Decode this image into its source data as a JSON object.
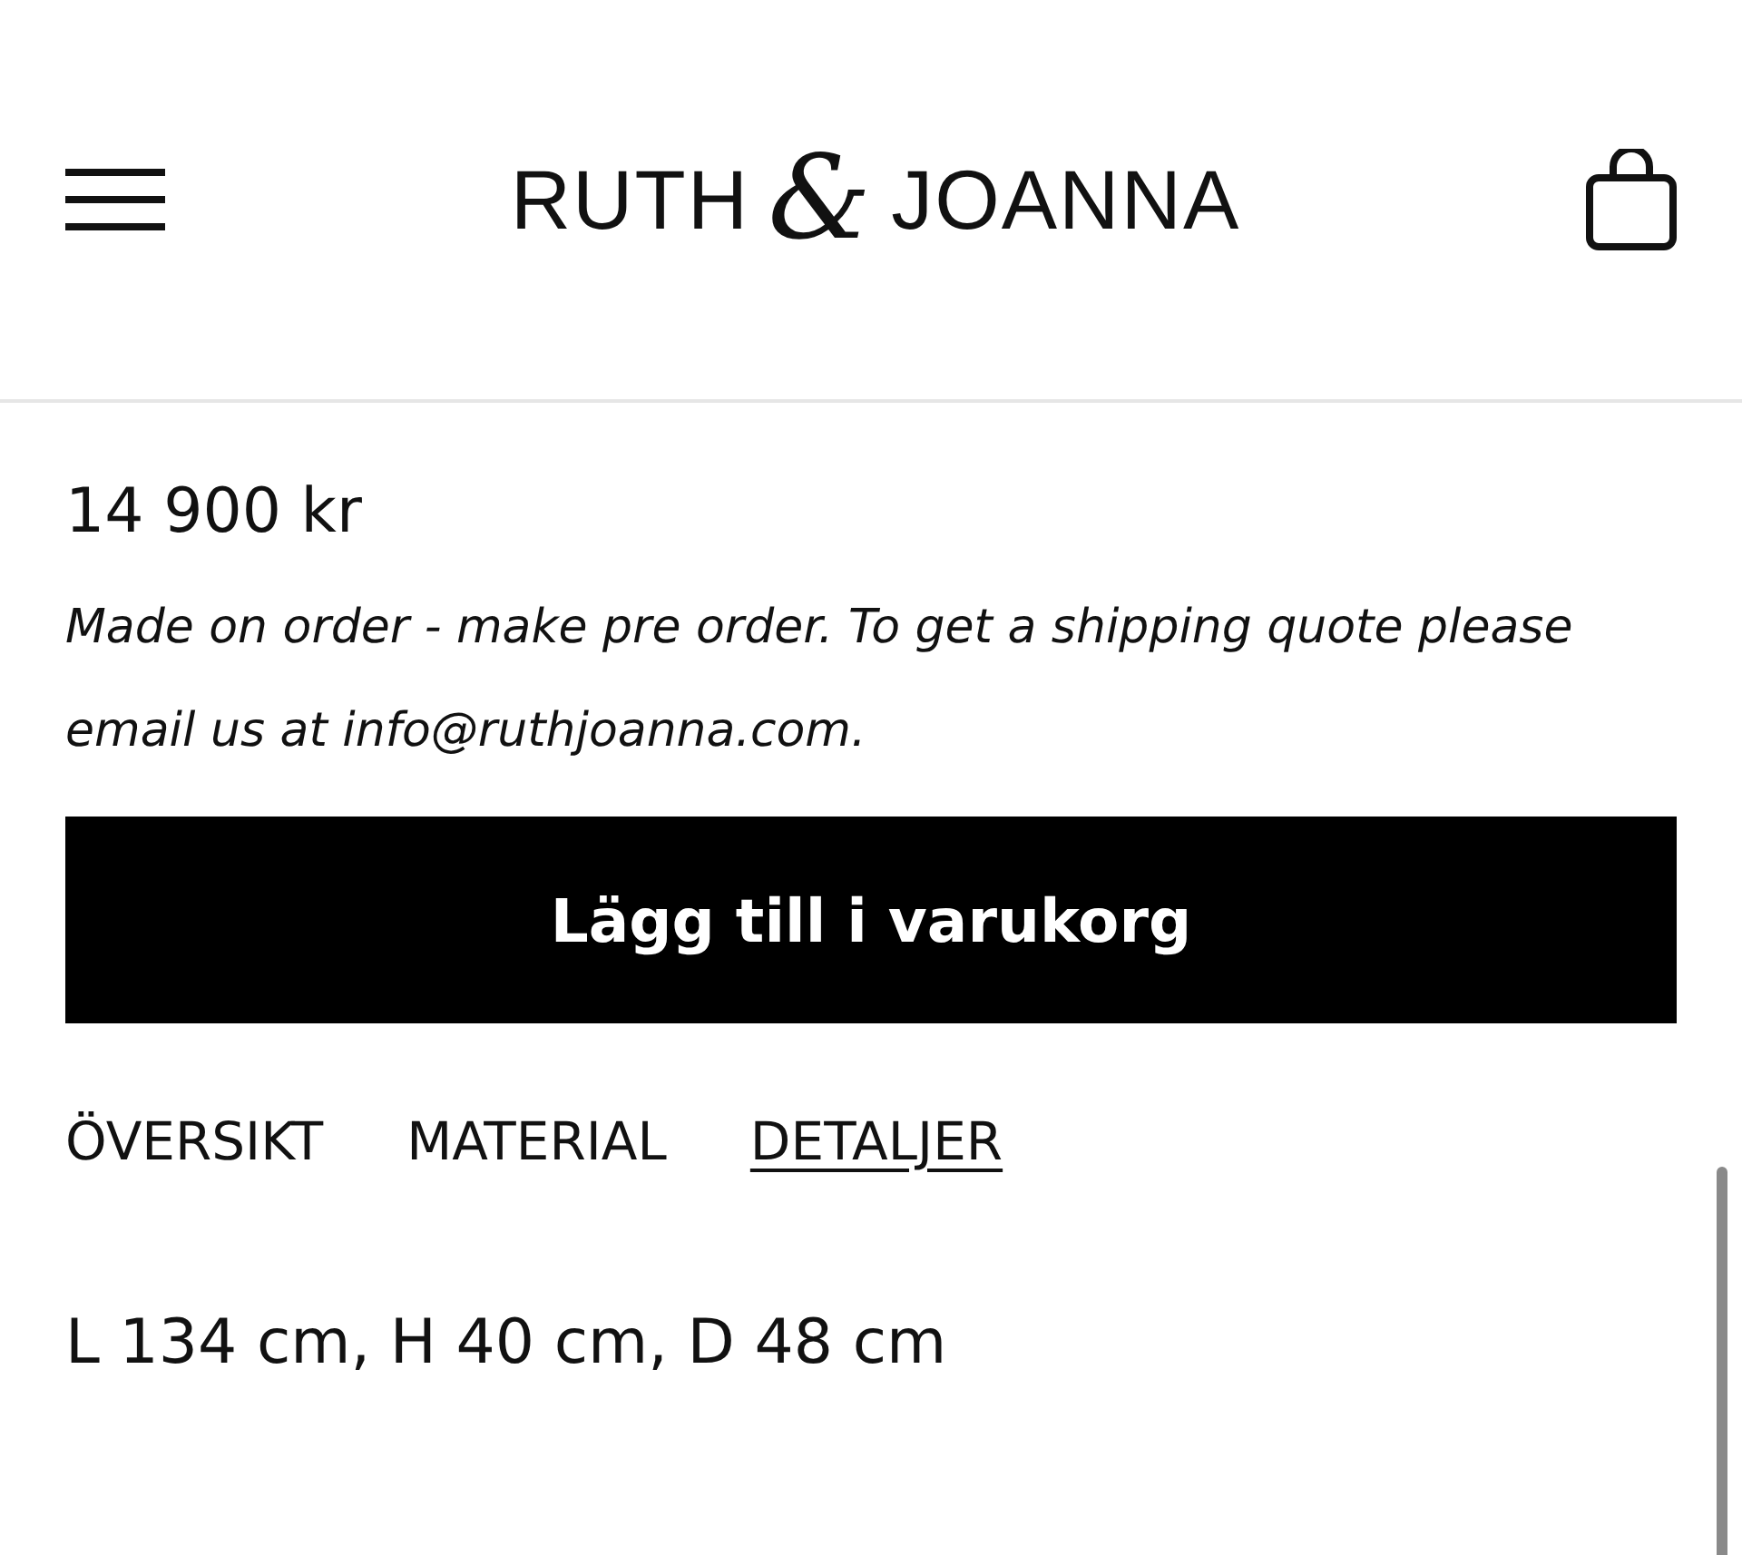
{
  "header": {
    "logo": {
      "left": "RUTH",
      "ampersand": "&",
      "right": "JOANNA"
    }
  },
  "product": {
    "price": "14 900 kr",
    "note": "Made on order - make pre order. To get a shipping quote please email us at info@ruthjoanna.com.",
    "add_button": "Lägg till i varukorg"
  },
  "tabs": [
    {
      "label": "ÖVERSIKT",
      "selected": false
    },
    {
      "label": "MATERIAL",
      "selected": false
    },
    {
      "label": "DETALJER",
      "selected": true
    }
  ],
  "details": "L 134 cm, H 40 cm, D 48 cm"
}
